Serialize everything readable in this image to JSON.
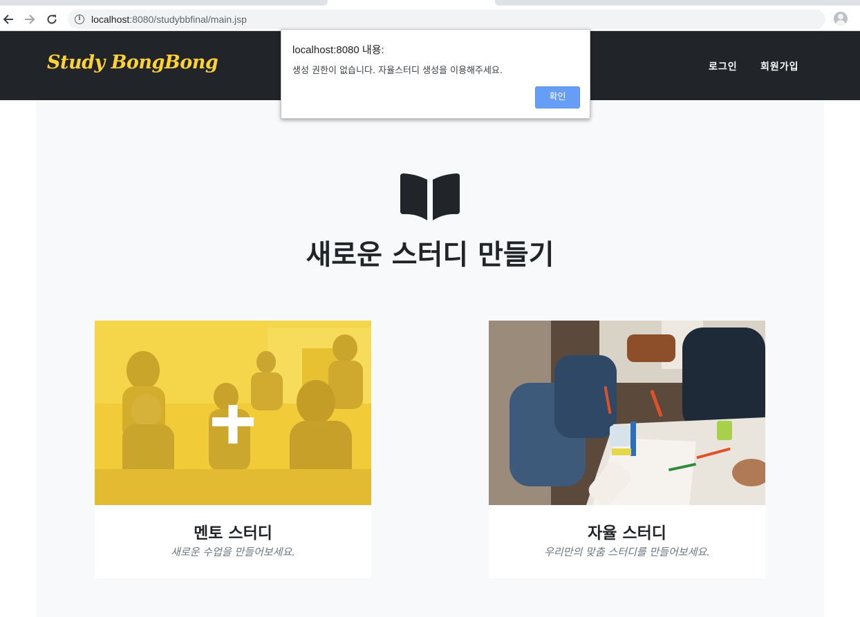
{
  "browser": {
    "url_host": "localhost",
    "url_rest": ":8080/studybbfinal/main.jsp"
  },
  "nav": {
    "brand": "Study BongBong",
    "login": "로그인",
    "signup": "회원가입"
  },
  "main": {
    "title": "새로운 스터디 만들기",
    "cards": [
      {
        "title": "멘토 스터디",
        "subtitle": "새로운 수업을 만들어보세요."
      },
      {
        "title": "자율 스터디",
        "subtitle": "우리만의 맞춤 스터디를 만들어보세요."
      }
    ]
  },
  "dialog": {
    "title": "localhost:8080 내용:",
    "message": "생성 권한이 없습니다. 자율스터디 생성을 이용해주세요.",
    "ok": "확인"
  },
  "colors": {
    "nav_bg": "#212529",
    "brand": "#fed136",
    "accent_overlay": "#fed136",
    "button": "#669df6"
  }
}
